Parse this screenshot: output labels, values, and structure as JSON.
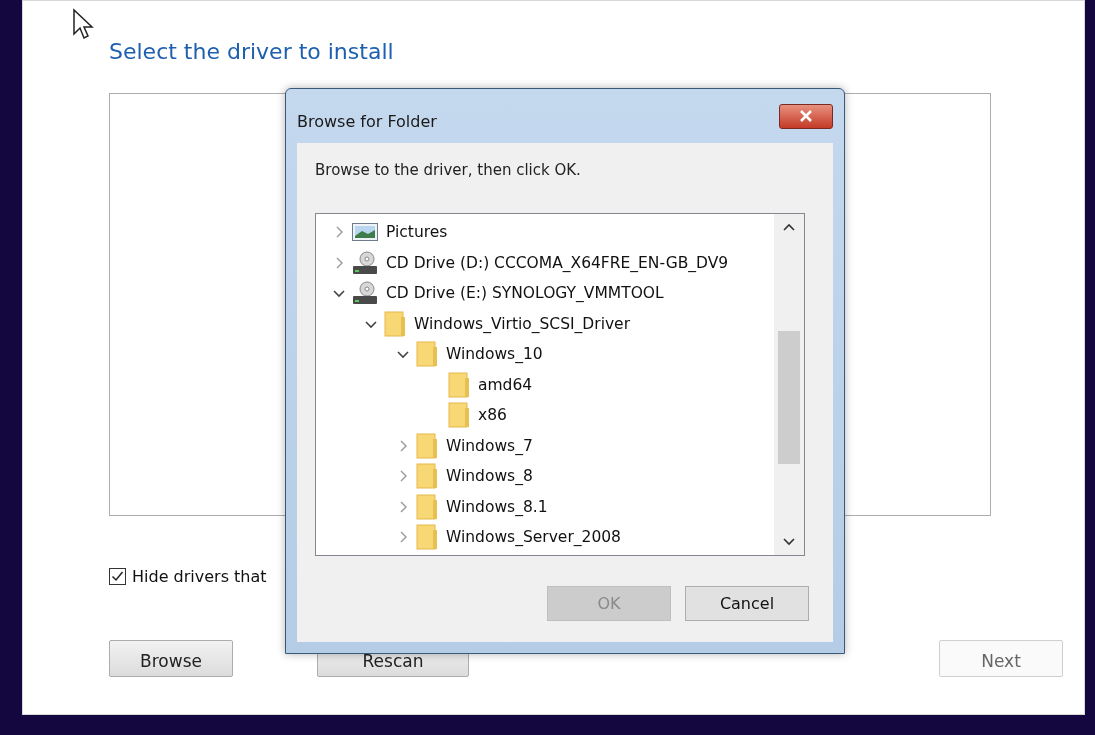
{
  "wizard": {
    "heading": "Select the driver to install",
    "hide_checkbox": {
      "label": "Hide drivers that",
      "checked": true
    },
    "buttons": [
      {
        "label": "Browse",
        "disabled": false
      },
      {
        "label": "Rescan",
        "disabled": false
      },
      {
        "label": "Next",
        "disabled": true
      }
    ]
  },
  "dialog": {
    "title": "Browse for Folder",
    "instruction": "Browse to the driver, then click OK.",
    "tree": [
      {
        "label": "Pictures",
        "kind": "picture",
        "expanded": false
      },
      {
        "label": "CD Drive (D:) CCCOMA_X64FRE_EN-GB_DV9",
        "kind": "drive",
        "expanded": false
      },
      {
        "label": "CD Drive (E:) SYNOLOGY_VMMTOOL",
        "kind": "drive",
        "expanded": true,
        "children": [
          {
            "label": "Windows_Virtio_SCSI_Driver",
            "kind": "folder",
            "expanded": true,
            "children": [
              {
                "label": "Windows_10",
                "kind": "folder",
                "expanded": true,
                "children": [
                  {
                    "label": "amd64",
                    "kind": "folder"
                  },
                  {
                    "label": "x86",
                    "kind": "folder"
                  }
                ]
              },
              {
                "label": "Windows_7",
                "kind": "folder",
                "expanded": false
              },
              {
                "label": "Windows_8",
                "kind": "folder",
                "expanded": false
              },
              {
                "label": "Windows_8.1",
                "kind": "folder",
                "expanded": false
              },
              {
                "label": "Windows_Server_2008",
                "kind": "folder",
                "expanded": false
              }
            ]
          }
        ]
      }
    ],
    "buttons": [
      {
        "label": "OK",
        "disabled": true
      },
      {
        "label": "Cancel",
        "disabled": false
      }
    ]
  }
}
